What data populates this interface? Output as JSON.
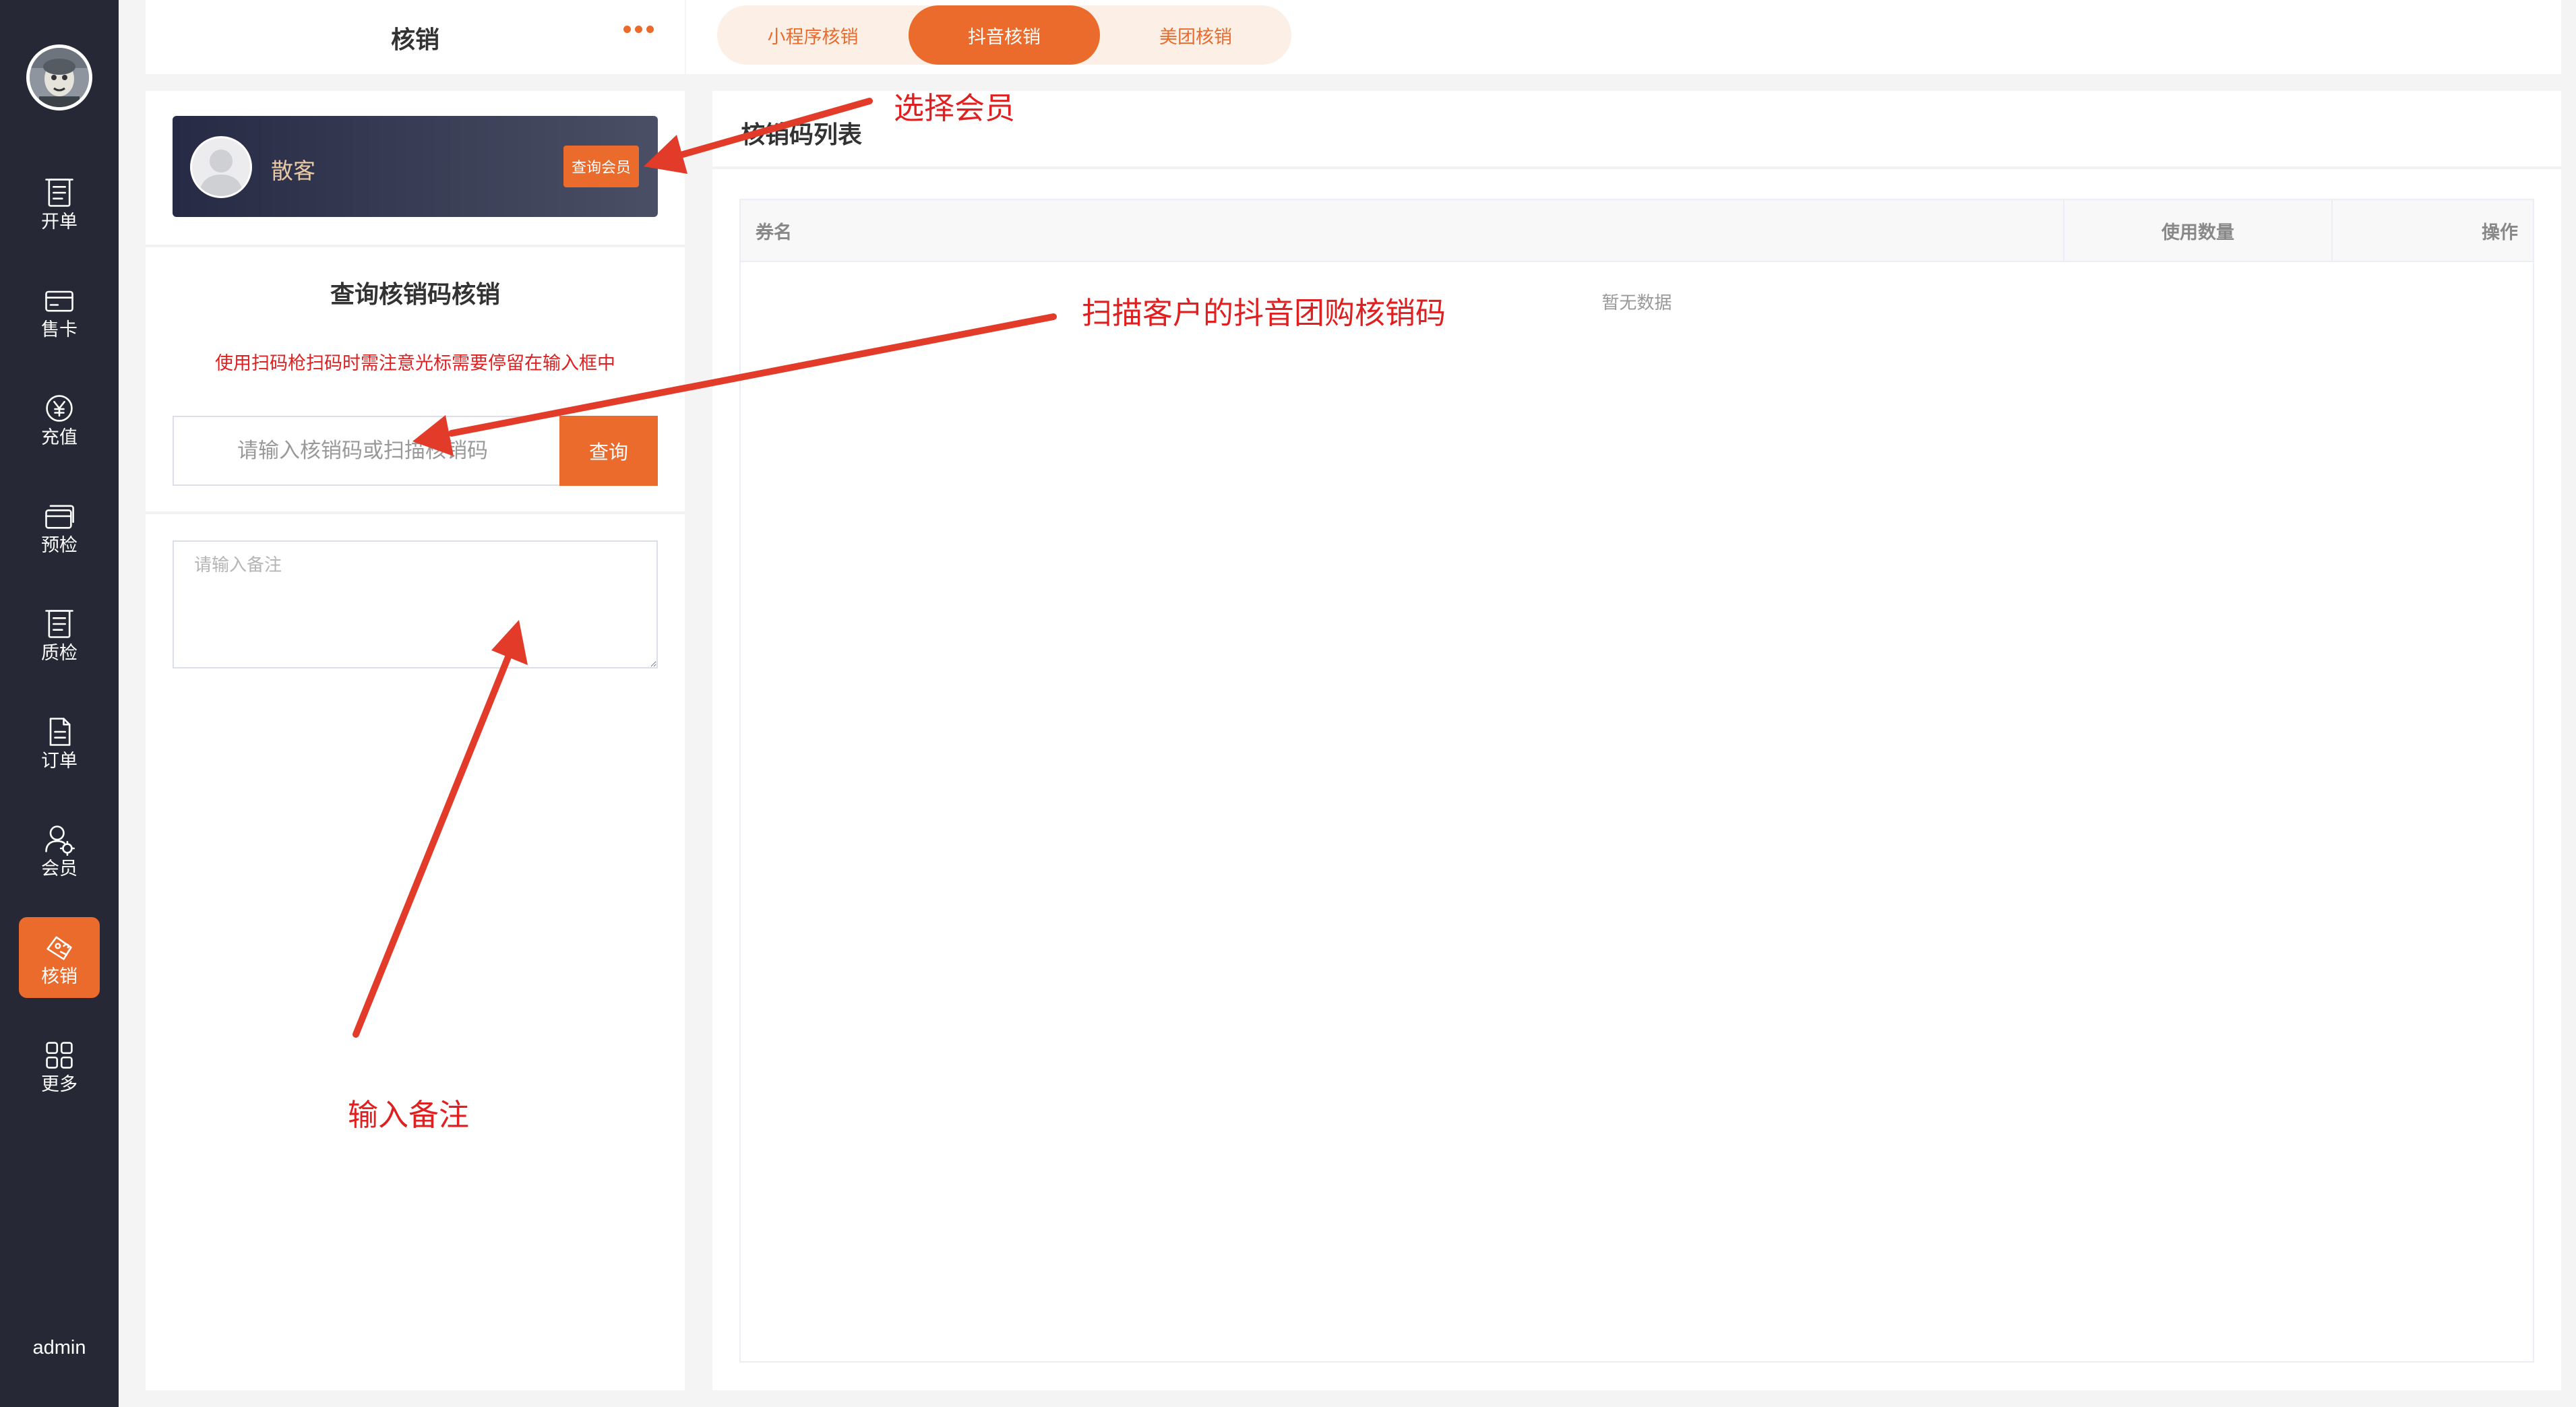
{
  "sidebar": {
    "avatar": "user-avatar",
    "items": [
      {
        "label": "开单",
        "icon": "receipt-icon"
      },
      {
        "label": "售卡",
        "icon": "card-icon"
      },
      {
        "label": "充值",
        "icon": "yen-coin-icon"
      },
      {
        "label": "预检",
        "icon": "card-stack-icon"
      },
      {
        "label": "质检",
        "icon": "checklist-icon"
      },
      {
        "label": "订单",
        "icon": "document-icon"
      },
      {
        "label": "会员",
        "icon": "member-icon"
      },
      {
        "label": "核销",
        "icon": "redeem-icon",
        "active": true
      },
      {
        "label": "更多",
        "icon": "grid-icon"
      }
    ],
    "user": "admin"
  },
  "header": {
    "title": "核销",
    "more_icon": "more-dots-icon",
    "tabs": [
      {
        "label": "小程序核销",
        "active": false
      },
      {
        "label": "抖音核销",
        "active": true
      },
      {
        "label": "美团核销",
        "active": false
      }
    ]
  },
  "member": {
    "name": "散客",
    "query_button": "查询会员"
  },
  "query": {
    "title": "查询核销码核销",
    "warning": "使用扫码枪扫码时需注意光标需要停留在输入框中",
    "input_placeholder": "请输入核销码或扫描核销码",
    "input_value": "",
    "button": "查询",
    "remark_placeholder": "请输入备注",
    "remark_value": ""
  },
  "list": {
    "title": "核销码列表",
    "columns": [
      "券名",
      "使用数量",
      "操作"
    ],
    "rows": [],
    "empty_text": "暂无数据"
  },
  "annotations": {
    "select_member": "选择会员",
    "scan_code": "扫描客户的抖音团购核销码",
    "input_remark": "输入备注"
  },
  "colors": {
    "accent": "#ea6b2c",
    "sidebar_bg": "#262836",
    "warning": "#e02020",
    "annotation": "#e02020"
  }
}
